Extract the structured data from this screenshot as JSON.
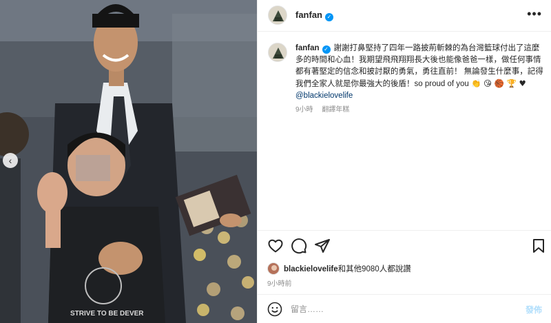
{
  "post": {
    "username": "fanfan",
    "verified": true,
    "caption_text": "謝謝打鼻堅持了四年一路披荊斬棘的為台灣籃球付出了這麼多的時間和心血！我期望飛飛翔翔長大後也能像爸爸一樣，做任何事情都有著堅定的信念和披討厭的勇氣，勇往直前！ 無論發生什麼事，記得我們全家人就是你最強大的後盾！so proud of you",
    "caption_emojis": "👏 😘 🏀 🏆 ♥",
    "mention": "@blackielovelife",
    "time_ago": "9小時",
    "translate_label": "翻譯年糕"
  },
  "likes": {
    "user": "blackielovelife",
    "text": "和其他9080人都說讚",
    "time": "9小時前"
  },
  "comment": {
    "placeholder": "留言……",
    "post_label": "發佈"
  },
  "icons": {
    "more": "more-options-icon",
    "like": "heart-icon",
    "comment": "comment-icon",
    "share": "paper-plane-icon",
    "save": "bookmark-icon",
    "emoji": "smiley-icon",
    "carousel": "chevron-left-icon"
  },
  "colors": {
    "verified": "#0095f6",
    "mention": "#00376b",
    "muted": "#8e8e8e",
    "post_button": "#b2dffc"
  }
}
